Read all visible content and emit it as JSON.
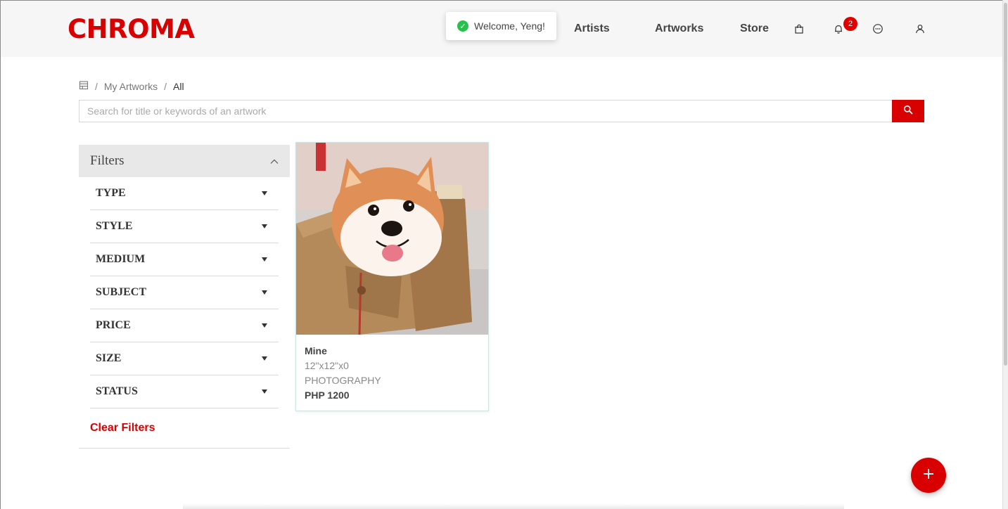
{
  "app": {
    "logo": "CHROMA",
    "brand_color": "#d80000"
  },
  "toast": {
    "message": "Welcome, Yeng!",
    "icon": "check-circle-icon"
  },
  "nav": {
    "artists": "Artists",
    "artworks": "Artworks",
    "store": "Store"
  },
  "header_icons": {
    "bag": "shopping-bag-icon",
    "bell": "bell-icon",
    "chat": "chat-icon",
    "user": "user-icon",
    "notification_count": "2"
  },
  "breadcrumb": {
    "home_icon": "store-icon",
    "sep1": "/",
    "level1": "My Artworks",
    "sep2": "/",
    "current": "All"
  },
  "search": {
    "placeholder": "Search for title or keywords of an artwork",
    "value": "",
    "button_icon": "search-icon"
  },
  "filters": {
    "title": "Filters",
    "items": [
      "TYPE",
      "STYLE",
      "MEDIUM",
      "SUBJECT",
      "PRICE",
      "SIZE",
      "STATUS"
    ],
    "clear_label": "Clear Filters"
  },
  "artwork": {
    "title": "Mine",
    "dimensions": "12\"x12\"x0",
    "medium": "PHOTOGRAPHY",
    "price": "PHP 1200"
  },
  "fab": {
    "icon": "plus-icon"
  }
}
